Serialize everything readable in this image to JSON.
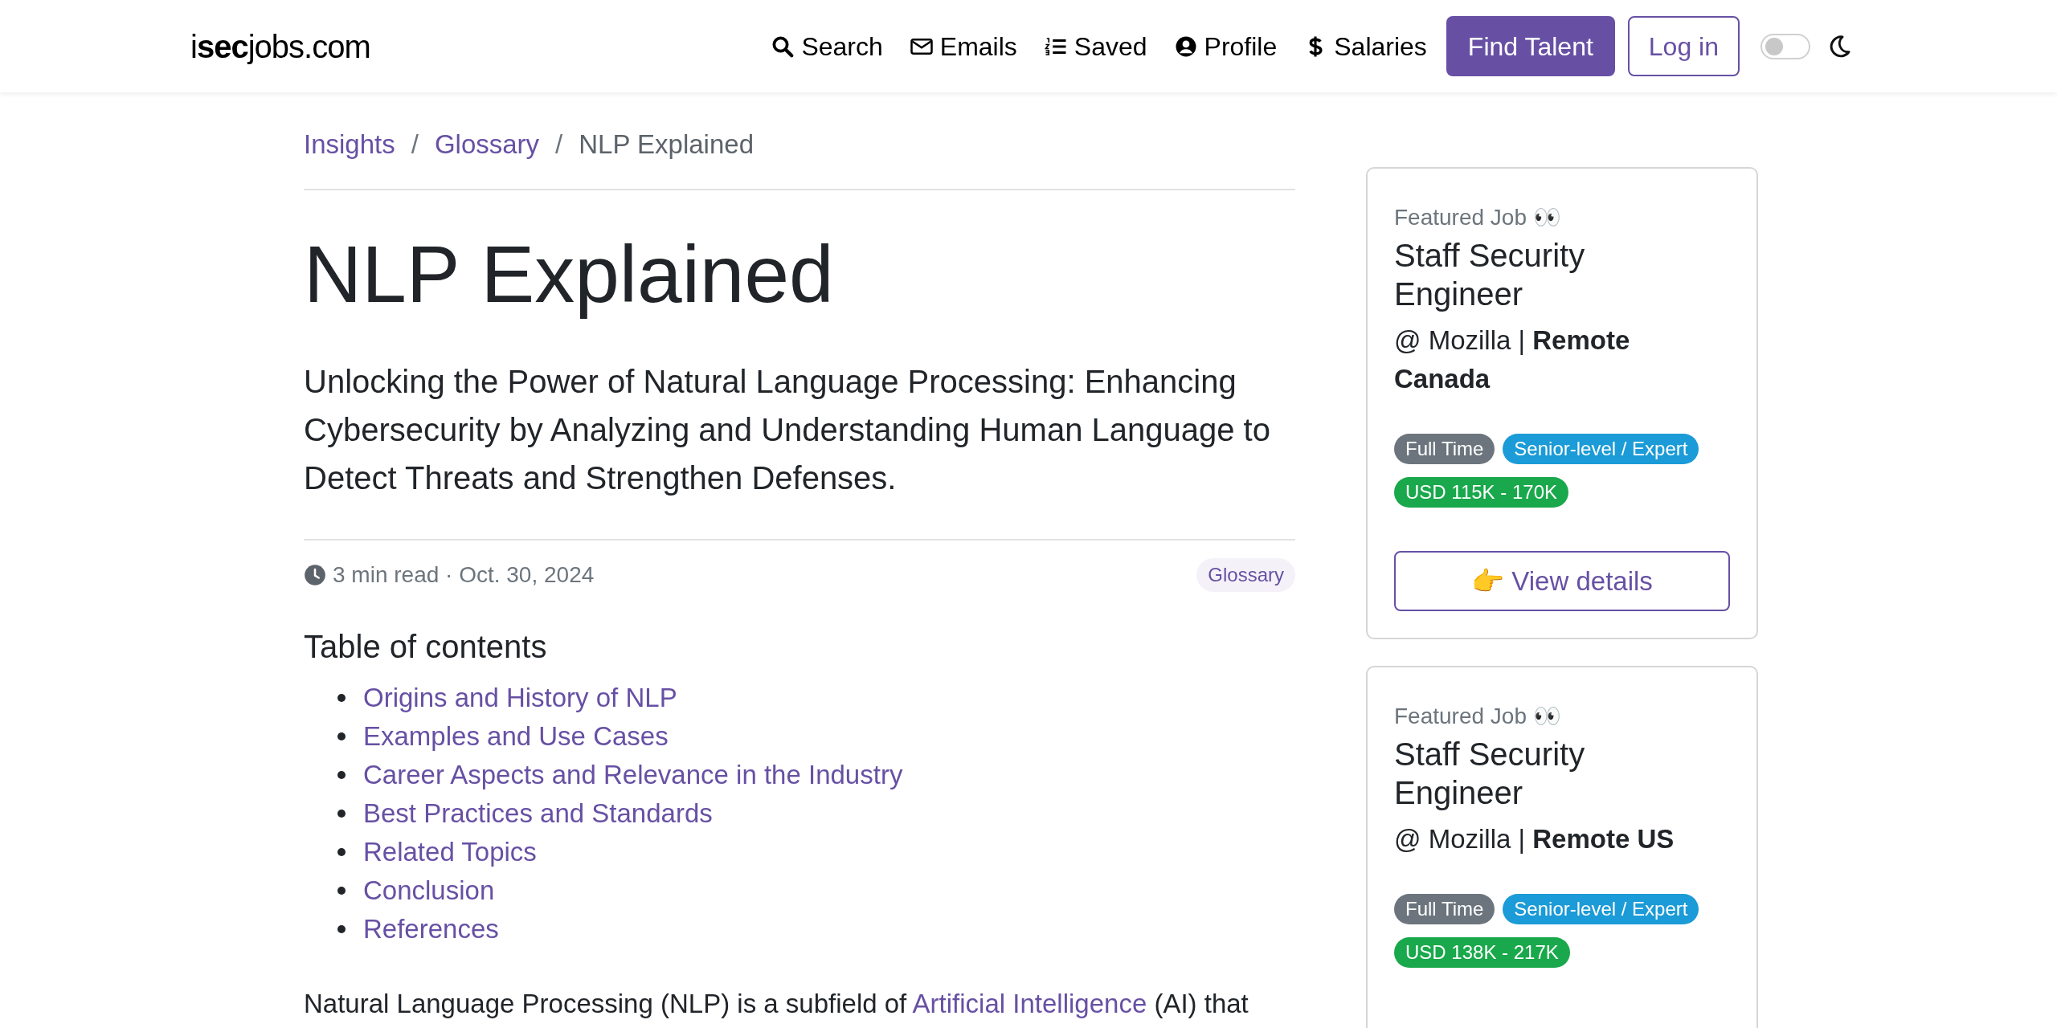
{
  "navbar": {
    "logo": "i**sec**jobs.com",
    "links": [
      {
        "kind": "search",
        "label": "Search"
      },
      {
        "kind": "envelope",
        "label": "Emails"
      },
      {
        "kind": "list",
        "label": "Saved"
      },
      {
        "kind": "user",
        "label": "Profile"
      },
      {
        "kind": "dollar",
        "label": "Salaries"
      }
    ],
    "find_talent": "Find Talent",
    "login": "Log in",
    "dark_mode": {
      "on": false
    }
  },
  "breadcrumb": [
    {
      "kind": "link",
      "text": "Insights"
    },
    {
      "kind": "separator",
      "text": "/"
    },
    {
      "kind": "link",
      "text": "Glossary"
    },
    {
      "kind": "separator",
      "text": "/"
    },
    {
      "kind": "current",
      "text": "NLP Explained"
    }
  ],
  "article": {
    "title": "NLP Explained",
    "subtitle": "Unlocking the Power of Natural Language Processing: Enhancing Cybersecurity by Analyzing and Understanding Human Language to Detect Threats and Strengthen Defenses.",
    "meta": "3 min read · Oct. 30, 2024",
    "category": "Glossary",
    "toc_heading": "Table of contents",
    "toc": [
      "Origins and History of NLP",
      "Examples and Use Cases",
      "Career Aspects and Relevance in the Industry",
      "Best Practices and Standards",
      "Related Topics",
      "Conclusion",
      "References"
    ],
    "paragraph": [
      {
        "kind": "text",
        "text": "Natural Language Processing (NLP) is a subfield of "
      },
      {
        "kind": "link",
        "text": "Artificial Intelligence"
      },
      {
        "kind": "text",
        "text": " (AI) that"
      }
    ]
  },
  "sidebar": [
    {
      "label": "Featured Job 👀",
      "title": "Staff Security Engineer",
      "company": "@ Mozilla | **Remote Canada**",
      "tags": [
        {
          "text": "Full Time",
          "color": "#6c757d"
        },
        {
          "text": "Senior-level / Expert",
          "color": "#1b9bd7"
        },
        {
          "text": "USD 115K - 170K",
          "color": "#19a84b"
        }
      ],
      "button": "👉 View details"
    },
    {
      "label": "Featured Job 👀",
      "title": "Staff Security Engineer",
      "company": "@ Mozilla | **Remote US**",
      "tags": [
        {
          "text": "Full Time",
          "color": "#6c757d"
        },
        {
          "text": "Senior-level / Expert",
          "color": "#1b9bd7"
        },
        {
          "text": "USD 138K - 217K",
          "color": "#19a84b"
        }
      ]
    }
  ]
}
